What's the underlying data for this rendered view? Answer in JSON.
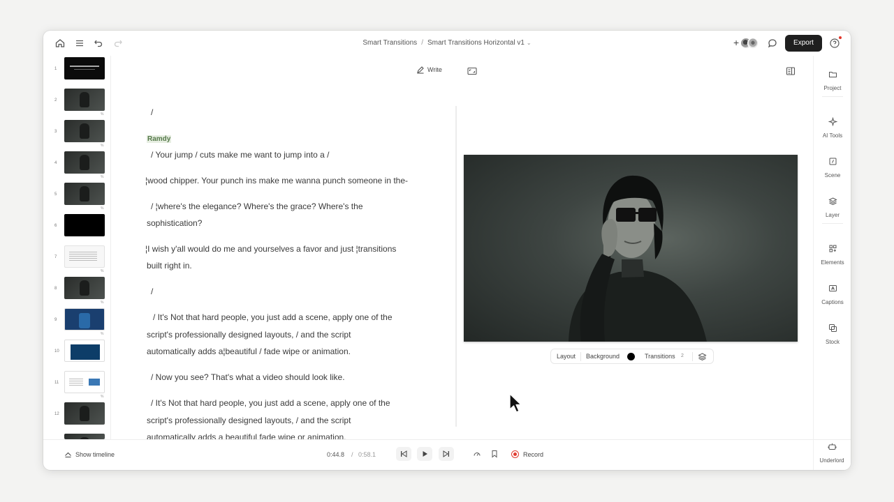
{
  "breadcrumb": {
    "project": "Smart Transitions",
    "composition": "Smart Transitions Horizontal v1"
  },
  "toolbar": {
    "export_label": "Export"
  },
  "script": {
    "write_label": "Write",
    "speaker": "Ramdy",
    "lines": [
      {
        "pre": "",
        "text": "/"
      },
      {
        "pre": "",
        "text": "/  Your jump  /  cuts make me want to jump into a  /"
      },
      {
        "pre": "",
        "text": "¦wood chipper. Your punch ins make me wanna punch someone in the-"
      },
      {
        "pre": "",
        "text": "/ ¦where's the elegance? Where's the grace? Where's the"
      },
      {
        "pre": "",
        "text": "sophistication?"
      },
      {
        "pre": "",
        "text": "¦I wish y'all would do me and yourselves a favor and just ¦transitions"
      },
      {
        "pre": "",
        "text": "built right in."
      },
      {
        "pre": "",
        "text": "/"
      },
      {
        "pre": "",
        "text": "/  It's Not that hard people, you just add a scene, apply one of the"
      },
      {
        "pre": "",
        "text": "script's professionally designed layouts,   /   and the script"
      },
      {
        "pre": "",
        "text": "automatically adds a¦beautiful   /   fade wipe or animation."
      },
      {
        "pre": "",
        "text": "/  Now you see? That's what a video should look like."
      },
      {
        "pre": "",
        "text": "/  It's Not that hard people, you just add a scene, apply one of the"
      },
      {
        "pre": "",
        "text": "script's professionally designed layouts,   /   and the script"
      },
      {
        "pre": "",
        "text": "automatically adds a beautiful fade wipe or animation."
      }
    ]
  },
  "thumbnails": [
    "1",
    "2",
    "3",
    "4",
    "5",
    "6",
    "7",
    "8",
    "9",
    "10",
    "11",
    "12"
  ],
  "preview_toolbar": {
    "layout": "Layout",
    "background": "Background",
    "background_color": "#000000",
    "transitions": "Transitions",
    "transitions_count": "2"
  },
  "right_sidebar": [
    "Project",
    "AI Tools",
    "Scene",
    "Layer",
    "Elements",
    "Captions",
    "Stock"
  ],
  "underlord_label": "Underlord",
  "bottom": {
    "show_timeline": "Show timeline",
    "time_current": "0:44.8",
    "time_sep": "/",
    "time_total": "0:58.1",
    "record": "Record"
  },
  "colors": {
    "accent_record": "#e03c31",
    "export_bg": "#1f1f1f",
    "speaker_green": "#567a4b"
  }
}
